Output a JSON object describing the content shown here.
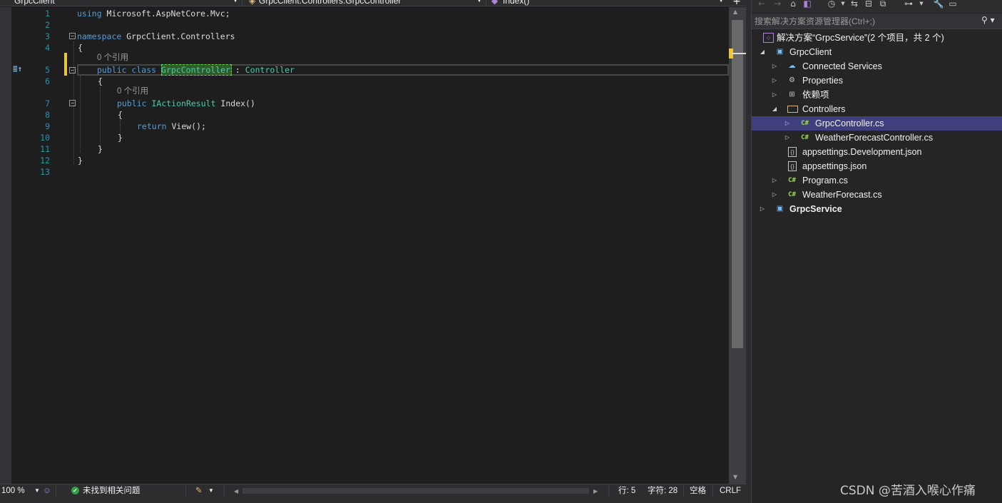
{
  "navbar": {
    "project_dropdown": "GrpcClient",
    "class_dropdown": "GrpcClient.Controllers.GrpcController",
    "member_dropdown": "Index()",
    "split_button": "+"
  },
  "editor": {
    "line_numbers": [
      "1",
      "2",
      "3",
      "4",
      "5",
      "6",
      "7",
      "8",
      "9",
      "10",
      "11",
      "12",
      "13"
    ],
    "code": {
      "l1_kw": "using",
      "l1_rest": " Microsoft.AspNetCore.Mvc;",
      "l3_kw": "namespace",
      "l3_rest": " GrpcClient.Controllers",
      "l4": "{",
      "l5_lens": "0 个引用",
      "l5_kw": "public class",
      "l5_sp": " ",
      "l5_name": "GrpcController",
      "l5_colon": " : ",
      "l5_base": "Controller",
      "l6": "{",
      "l7_lens": "0 个引用",
      "l7_kw": "public",
      "l7_sp": " ",
      "l7_type": "IActionResult",
      "l7_rest": " Index()",
      "l8": "{",
      "l9_kw": "return",
      "l9_rest": " View();",
      "l10": "}",
      "l11": "}",
      "l12": "}"
    },
    "bookmark_glyph": "≣↑"
  },
  "statusbar": {
    "zoom": "100 %",
    "issues": "未找到相关问题",
    "line": "行: 5",
    "char": "字符: 28",
    "whitespace": "空格",
    "line_ending": "CRLF"
  },
  "explorer": {
    "search_placeholder": "搜索解决方案资源管理器(Ctrl+;)",
    "solution_label": "解决方案“GrpcService”(2 个项目，共 2 个)",
    "items": [
      {
        "label": "GrpcClient"
      },
      {
        "label": "Connected Services"
      },
      {
        "label": "Properties"
      },
      {
        "label": "依赖项"
      },
      {
        "label": "Controllers"
      },
      {
        "label": "GrpcController.cs"
      },
      {
        "label": "WeatherForecastController.cs"
      },
      {
        "label": "appsettings.Development.json"
      },
      {
        "label": "appsettings.json"
      },
      {
        "label": "Program.cs"
      },
      {
        "label": "WeatherForecast.cs"
      },
      {
        "label": "GrpcService"
      }
    ]
  },
  "icons": {
    "csharp": "C#",
    "json": "{}",
    "solution": "◇"
  },
  "watermark": "CSDN @苦酒入喉心作痛",
  "colors": {
    "editor_bg": "#1e1e1e",
    "keyword": "#569cd6",
    "type": "#4ec9b0",
    "line_number": "#2b91af",
    "selection": "#3f3f7f",
    "change_marker": "#efc63a"
  }
}
